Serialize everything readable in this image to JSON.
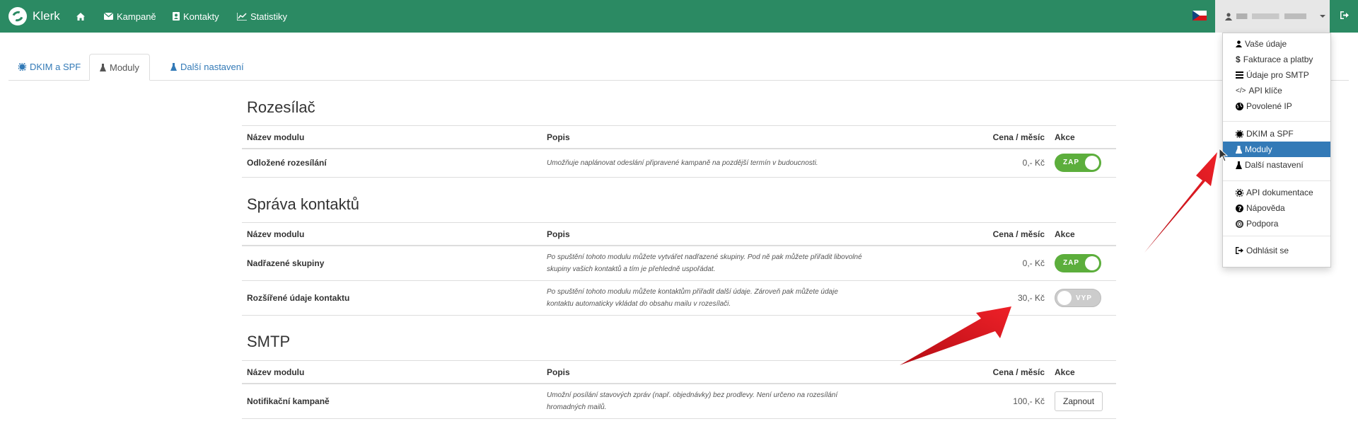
{
  "navbar": {
    "brand": "Klerk",
    "links": [
      {
        "label": "",
        "icon": "home-icon"
      },
      {
        "label": "Kampaně",
        "icon": "envelope-icon"
      },
      {
        "label": "Kontakty",
        "icon": "contact-card-icon"
      },
      {
        "label": "Statistiky",
        "icon": "line-chart-icon"
      }
    ],
    "flag": "czech-flag-icon",
    "user_menu_icon": "user-icon",
    "logout_icon": "logout-icon"
  },
  "tabs": [
    {
      "label": "DKIM a SPF",
      "icon": "gear-icon",
      "active": false
    },
    {
      "label": "Moduly",
      "icon": "flask-icon",
      "active": true
    },
    {
      "label": "Další nastavení",
      "icon": "flask-icon",
      "active": false
    }
  ],
  "columns": {
    "name": "Název modulu",
    "desc": "Popis",
    "price": "Cena / měsíc",
    "action": "Akce"
  },
  "sections": [
    {
      "title": "Rozesílač",
      "rows": [
        {
          "name": "Odložené rozesílání",
          "desc": "Umožňuje naplánovat odeslání připravené kampaně na pozdější termín v budoucnosti.",
          "desc2": "",
          "price": "0,- Kč",
          "action": "ZAP"
        }
      ]
    },
    {
      "title": "Správa kontaktů",
      "rows": [
        {
          "name": "Nadřazené skupiny",
          "desc": "Po spuštění tohoto modulu můžete vytvářet nadřazené skupiny. Pod ně pak můžete přiřadit libovolné",
          "desc2": "skupiny vašich kontaktů a tím je přehledně uspořádat.",
          "price": "0,- Kč",
          "action": "ZAP"
        },
        {
          "name": "Rozšířené údaje kontaktu",
          "desc": "Po spuštění tohoto modulu můžete kontaktům přiřadit další údaje. Zároveň pak můžete údaje",
          "desc2": "kontaktu automaticky vkládat do obsahu mailu v rozesílači.",
          "price": "30,- Kč",
          "action": "VYP"
        }
      ]
    },
    {
      "title": "SMTP",
      "rows": [
        {
          "name": "Notifikační kampaně",
          "desc": "Umožní posílání stavových zpráv (např. objednávky) bez prodlevy. Není určeno na rozesílání",
          "desc2": "hromadných mailů.",
          "price": "100,- Kč",
          "action": "Zapnout"
        }
      ]
    }
  ],
  "dropdown": {
    "items": [
      {
        "label": "Vaše údaje",
        "icon": "user-icon"
      },
      {
        "label": "Fakturace a platby",
        "icon": "dollar-icon"
      },
      {
        "label": "Údaje pro SMTP",
        "icon": "list-icon"
      },
      {
        "label": "API klíče",
        "icon": "code-icon"
      },
      {
        "label": "Povolené IP",
        "icon": "globe-icon"
      },
      {
        "label": "DKIM a SPF",
        "icon": "gear-icon"
      },
      {
        "label": "Moduly",
        "icon": "flask-icon",
        "active": true
      },
      {
        "label": "Další nastavení",
        "icon": "flask-icon"
      },
      {
        "label": "API dokumentace",
        "icon": "cog-icon"
      },
      {
        "label": "Nápověda",
        "icon": "question-icon"
      },
      {
        "label": "Podpora",
        "icon": "lifebuoy-icon"
      },
      {
        "label": "Odhlásit se",
        "icon": "logout-icon"
      }
    ]
  },
  "colors": {
    "navbar": "#2b8a63",
    "toggle_on": "#5cae3c",
    "link": "#337ab7",
    "arrow": "#e0141e"
  }
}
